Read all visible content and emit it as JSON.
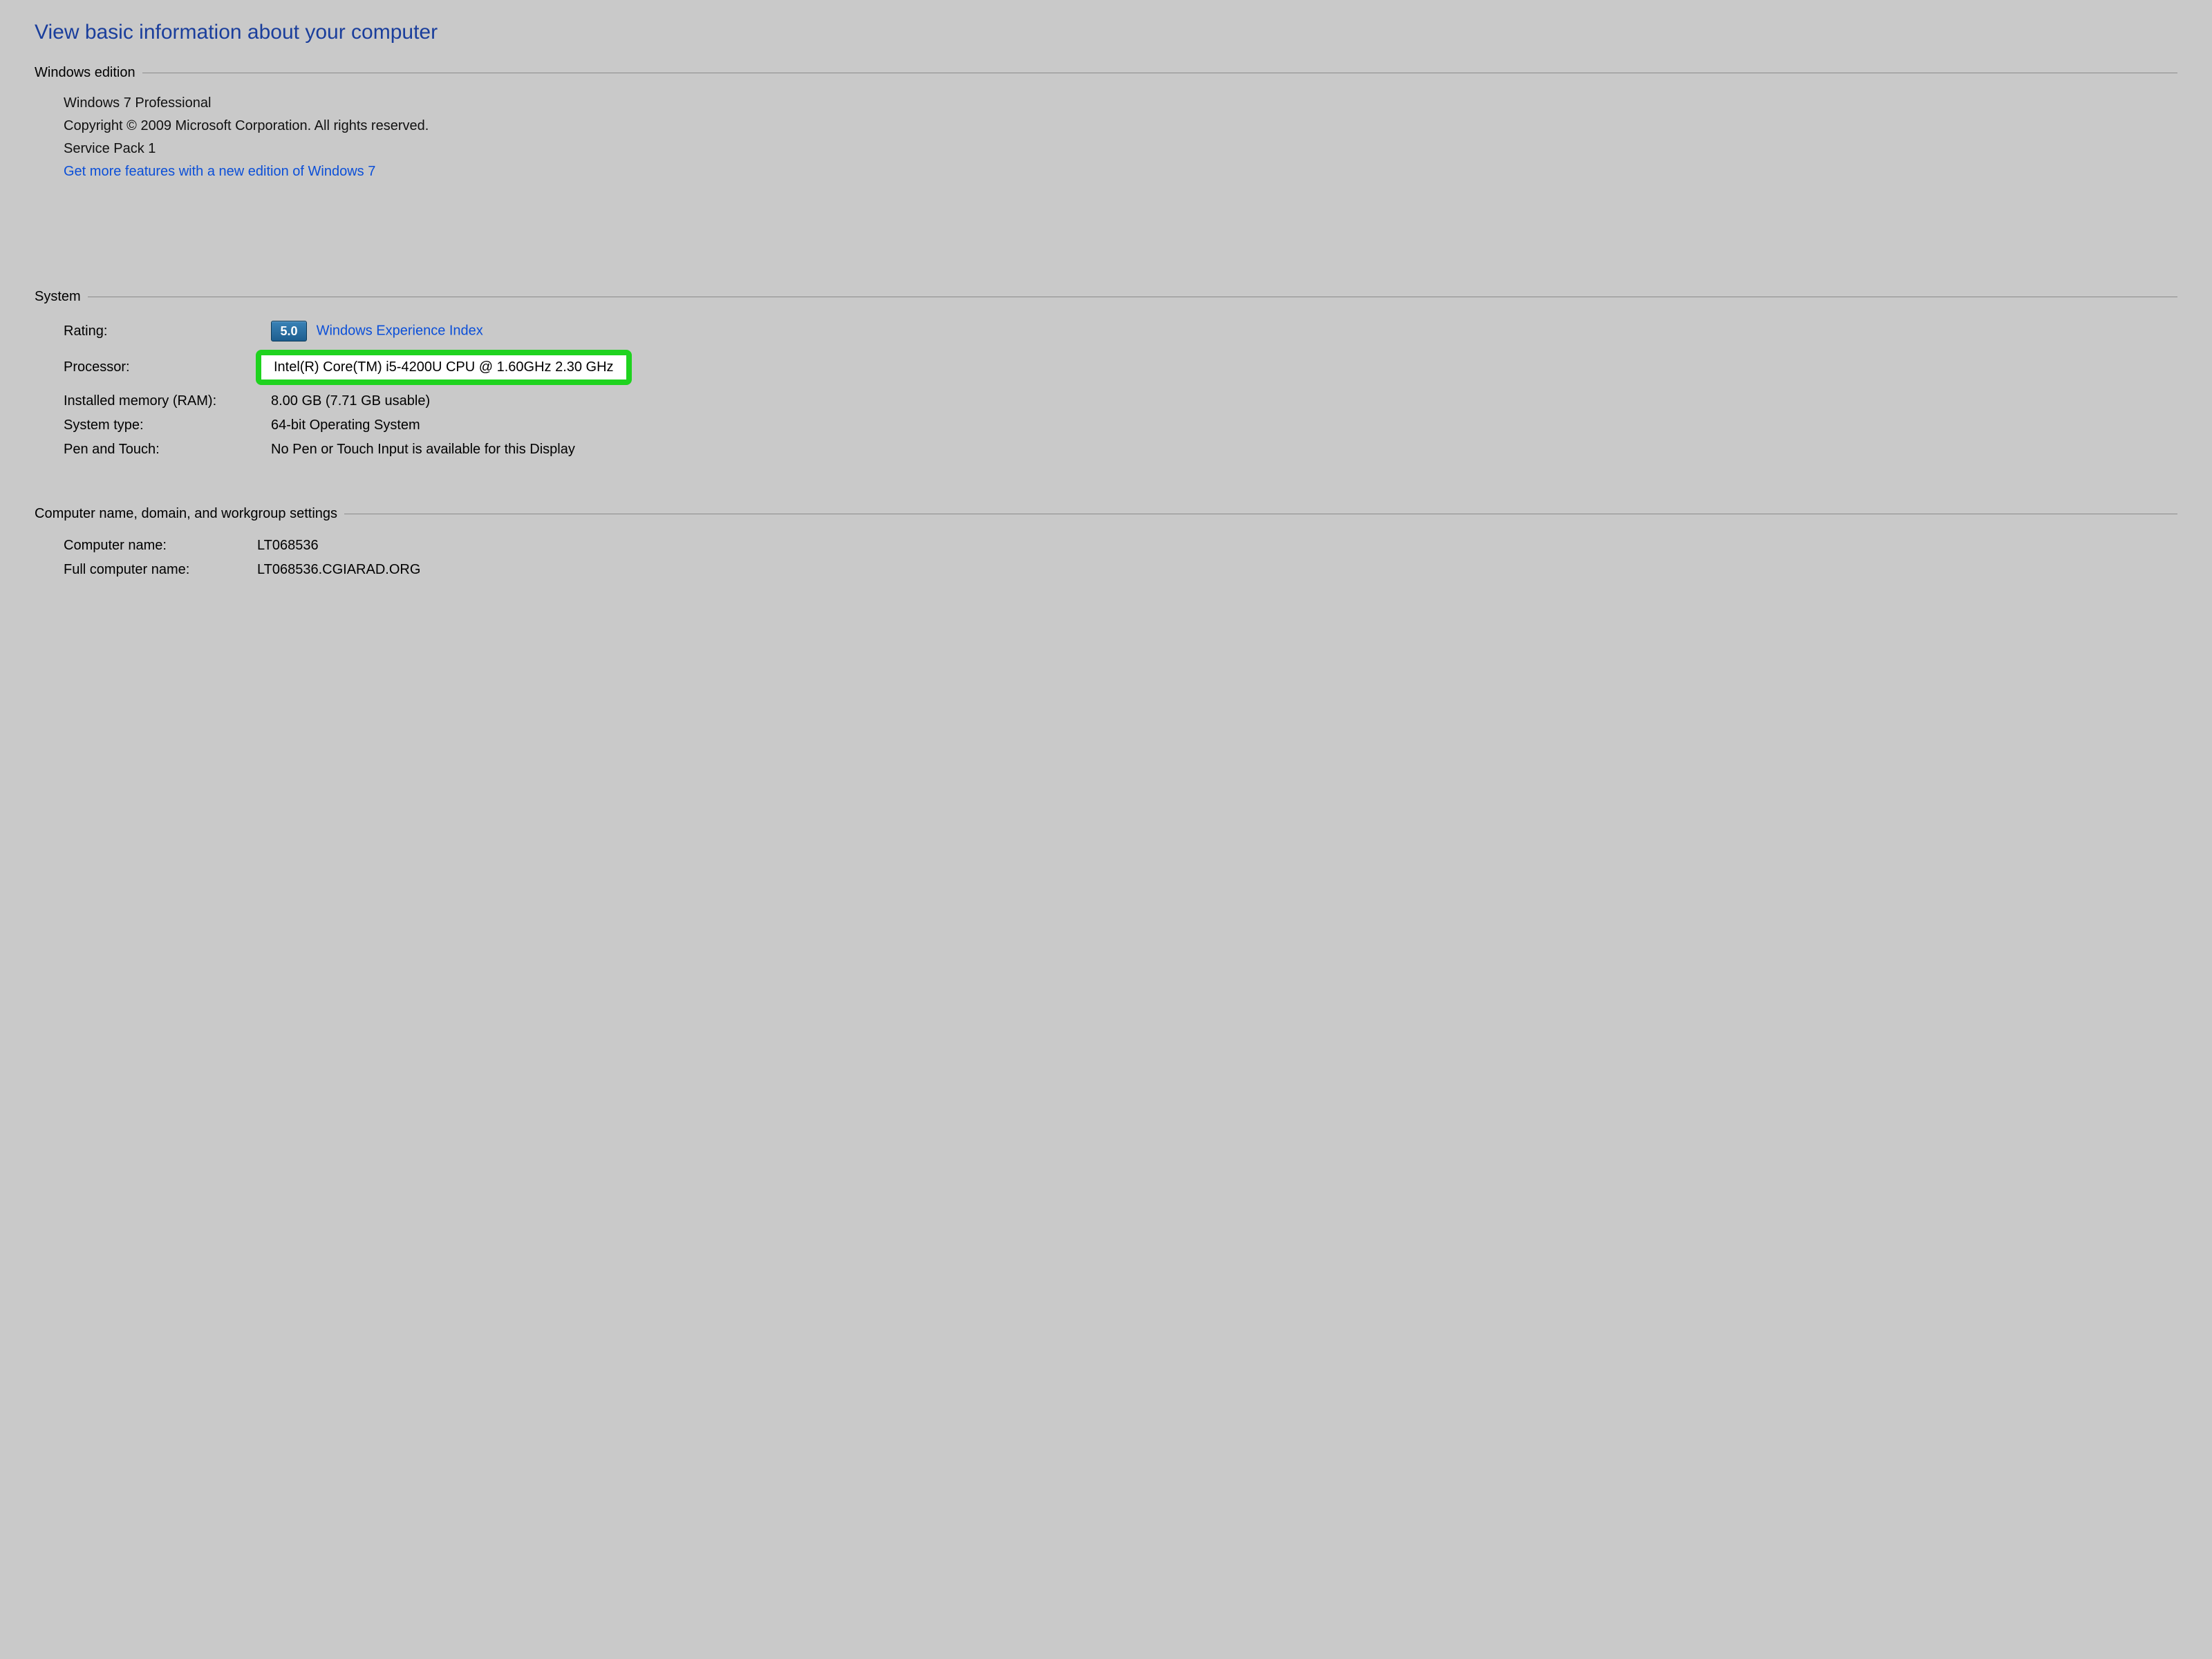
{
  "title": "View basic information about your computer",
  "windows_edition": {
    "legend": "Windows edition",
    "edition": "Windows 7 Professional",
    "copyright": "Copyright © 2009 Microsoft Corporation.  All rights reserved.",
    "service_pack": "Service Pack 1",
    "more_features_link": "Get more features with a new edition of Windows 7"
  },
  "system": {
    "legend": "System",
    "rating_label": "Rating:",
    "rating_value": "5.0",
    "rating_link": "Windows Experience Index",
    "processor_label": "Processor:",
    "processor_value": "Intel(R) Core(TM) i5-4200U CPU @ 1.60GHz  2.30 GHz",
    "ram_label": "Installed memory (RAM):",
    "ram_value": "8.00 GB (7.71 GB usable)",
    "system_type_label": "System type:",
    "system_type_value": "64-bit Operating System",
    "pen_touch_label": "Pen and Touch:",
    "pen_touch_value": "No Pen or Touch Input is available for this Display"
  },
  "computer_name_group": {
    "legend": "Computer name, domain, and workgroup settings",
    "computer_name_label": "Computer name:",
    "computer_name_value": "LT068536",
    "full_computer_name_label": "Full computer name:",
    "full_computer_name_value": "LT068536.CGIARAD.ORG"
  }
}
